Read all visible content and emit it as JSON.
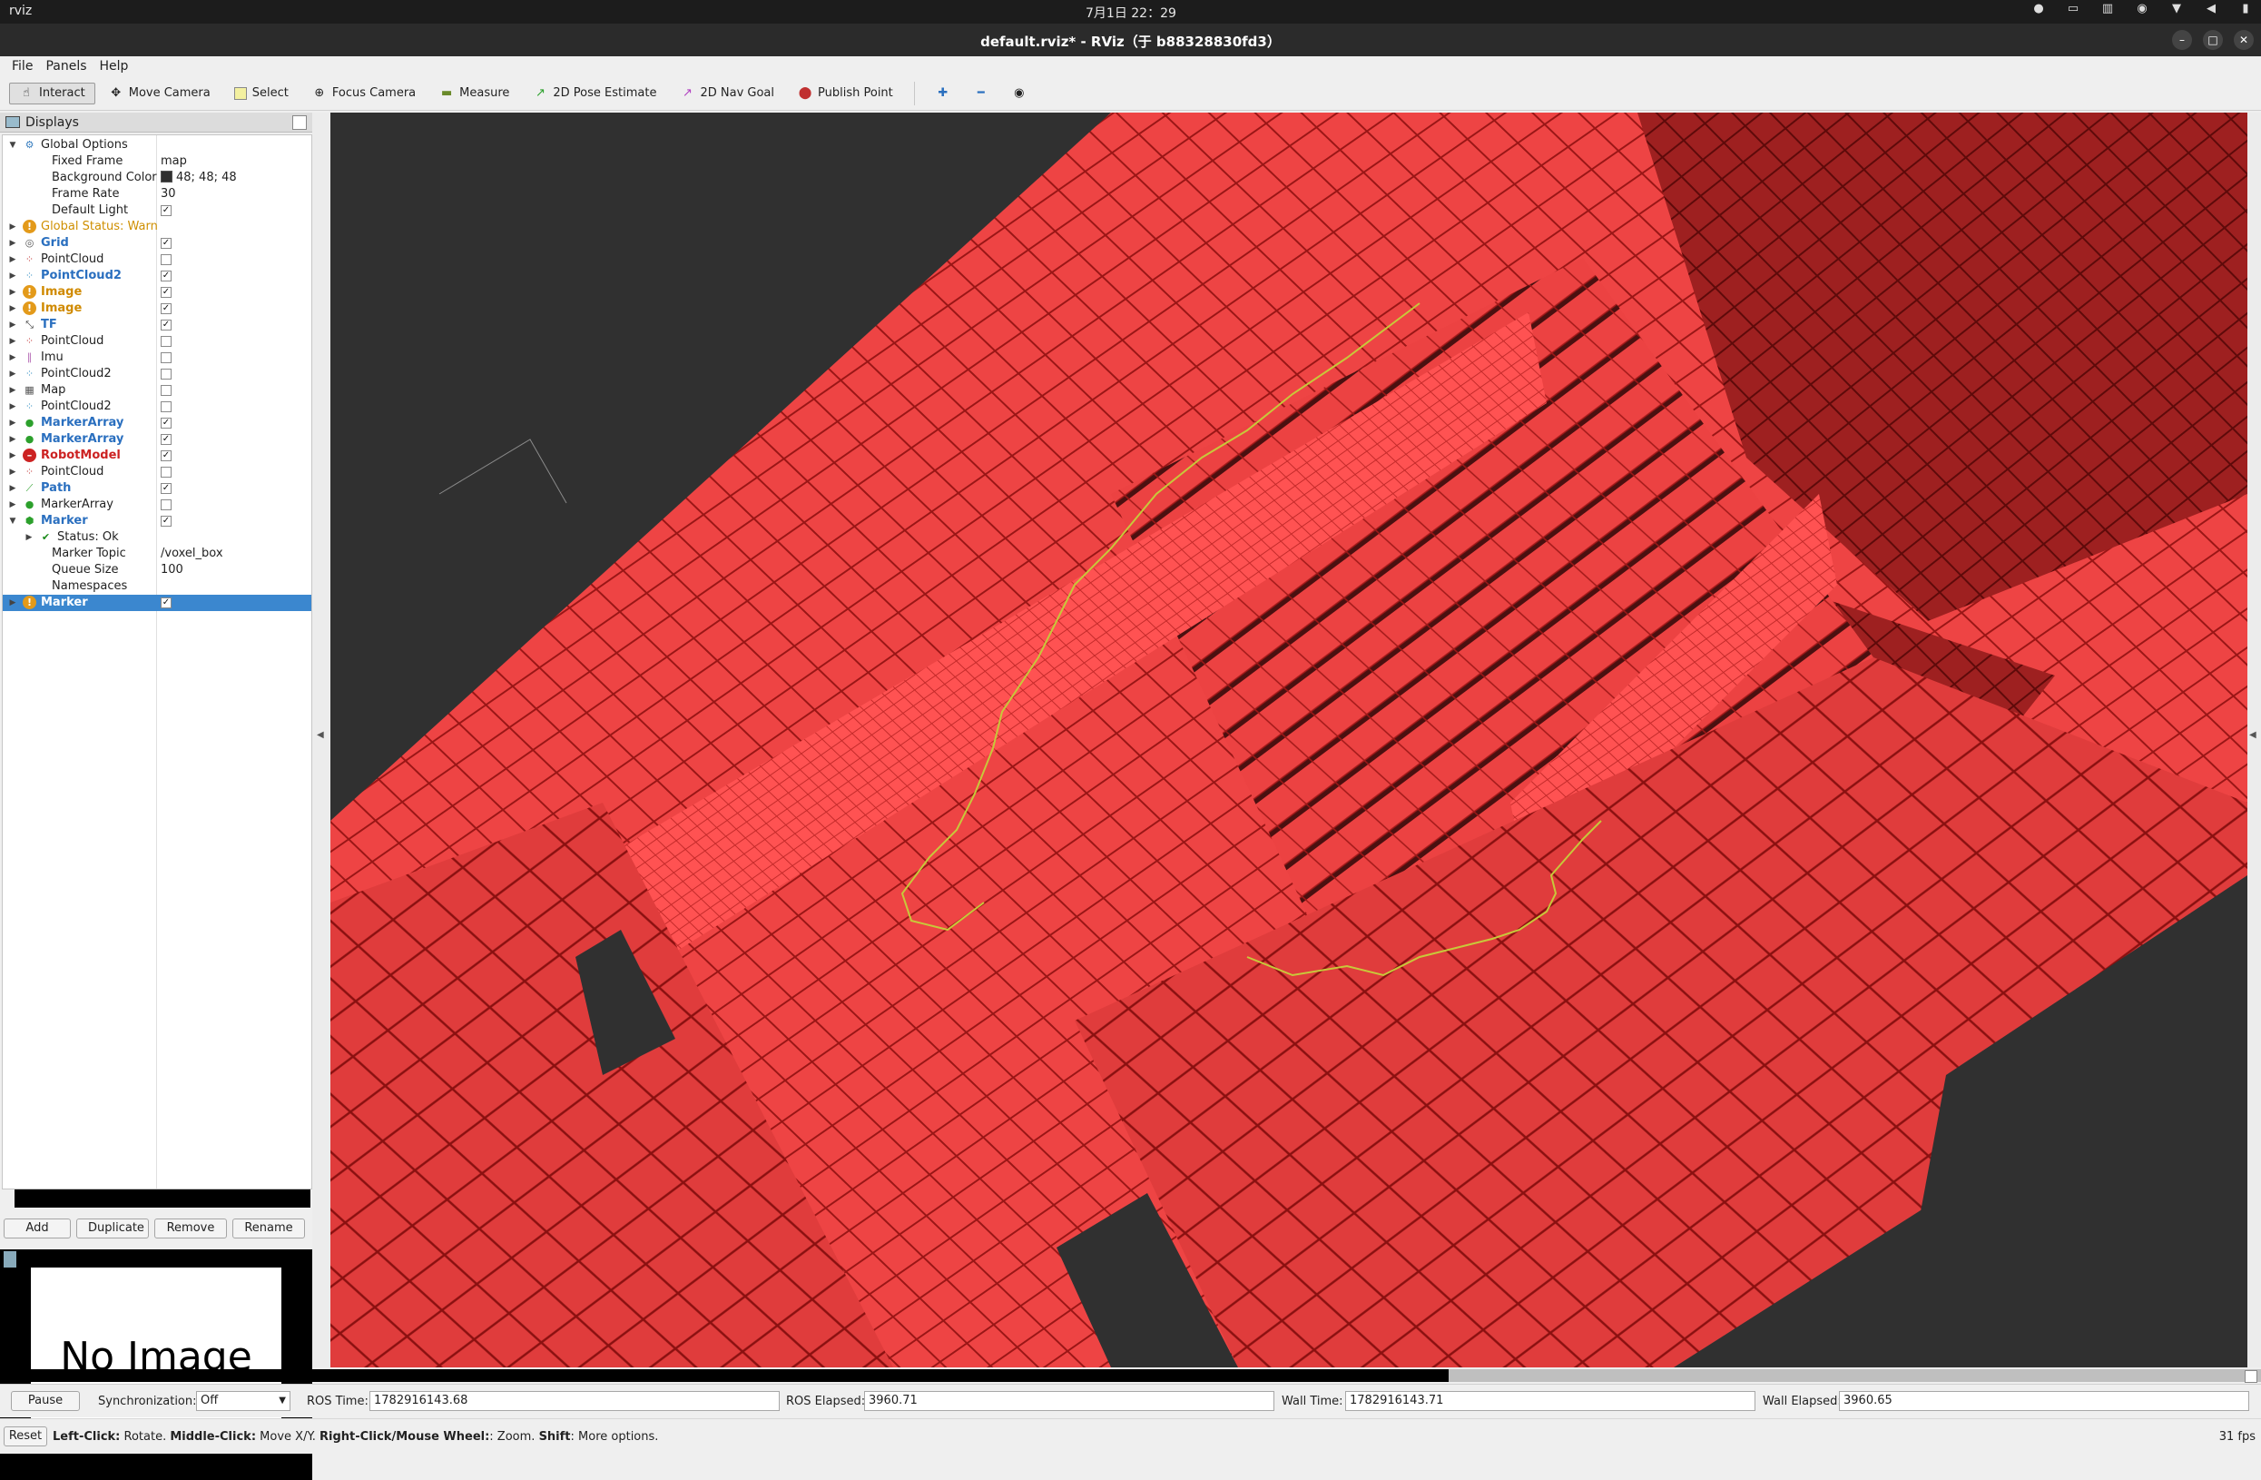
{
  "system_bar": {
    "app_name": "rviz",
    "clock": "7月1日  22：29"
  },
  "window": {
    "title": "default.rviz* - RViz（于 b88328830fd3）"
  },
  "menu": [
    "File",
    "Panels",
    "Help"
  ],
  "toolbar": {
    "tools": [
      {
        "label": "Interact",
        "icon": "hand-icon",
        "active": true
      },
      {
        "label": "Move Camera",
        "icon": "move-camera-icon"
      },
      {
        "label": "Select",
        "icon": "select-icon"
      },
      {
        "label": "Focus Camera",
        "icon": "focus-camera-icon"
      },
      {
        "label": "Measure",
        "icon": "measure-icon"
      },
      {
        "label": "2D Pose Estimate",
        "icon": "pose-estimate-icon"
      },
      {
        "label": "2D Nav Goal",
        "icon": "nav-goal-icon"
      },
      {
        "label": "Publish Point",
        "icon": "publish-point-icon"
      }
    ]
  },
  "displays_panel": {
    "title": "Displays",
    "rows": [
      {
        "label": "Global Options",
        "indent": 0,
        "expand": "open",
        "icon": "gear-icon"
      },
      {
        "label": "Fixed Frame",
        "indent": 1,
        "value": "map"
      },
      {
        "label": "Background Color",
        "indent": 1,
        "value": "48; 48; 48",
        "swatch": true
      },
      {
        "label": "Frame Rate",
        "indent": 1,
        "value": "30"
      },
      {
        "label": "Default Light",
        "indent": 1,
        "checkbox": true,
        "checked": true
      },
      {
        "label": "Global Status: Warn",
        "indent": 0,
        "expand": "closed",
        "icon": "warn-icon",
        "style": "warntxt"
      },
      {
        "label": "Grid",
        "indent": 0,
        "expand": "closed",
        "icon": "grid-icon",
        "style": "blue",
        "checkbox": true,
        "checked": true
      },
      {
        "label": "PointCloud",
        "indent": 0,
        "expand": "closed",
        "icon": "pointcloud-icon",
        "checkbox": true,
        "checked": false
      },
      {
        "label": "PointCloud2",
        "indent": 0,
        "expand": "closed",
        "icon": "pointcloud2-icon",
        "style": "blue",
        "checkbox": true,
        "checked": true
      },
      {
        "label": "Image",
        "indent": 0,
        "expand": "closed",
        "icon": "warn-icon",
        "style": "orange",
        "checkbox": true,
        "checked": true
      },
      {
        "label": "Image",
        "indent": 0,
        "expand": "closed",
        "icon": "warn-icon",
        "style": "orange",
        "checkbox": true,
        "checked": true
      },
      {
        "label": "TF",
        "indent": 0,
        "expand": "closed",
        "icon": "tf-icon",
        "style": "blue",
        "checkbox": true,
        "checked": true
      },
      {
        "label": "PointCloud",
        "indent": 0,
        "expand": "closed",
        "icon": "pointcloud-icon",
        "checkbox": true,
        "checked": false
      },
      {
        "label": "Imu",
        "indent": 0,
        "expand": "closed",
        "icon": "imu-icon",
        "checkbox": true,
        "checked": false
      },
      {
        "label": "PointCloud2",
        "indent": 0,
        "expand": "closed",
        "icon": "pointcloud2-icon",
        "checkbox": true,
        "checked": false
      },
      {
        "label": "Map",
        "indent": 0,
        "expand": "closed",
        "icon": "map-icon",
        "checkbox": true,
        "checked": false
      },
      {
        "label": "PointCloud2",
        "indent": 0,
        "expand": "closed",
        "icon": "pointcloud2-icon",
        "checkbox": true,
        "checked": false
      },
      {
        "label": "MarkerArray",
        "indent": 0,
        "expand": "closed",
        "icon": "marker-array-icon",
        "style": "blue",
        "checkbox": true,
        "checked": true
      },
      {
        "label": "MarkerArray",
        "indent": 0,
        "expand": "closed",
        "icon": "marker-array-icon",
        "style": "blue",
        "checkbox": true,
        "checked": true
      },
      {
        "label": "RobotModel",
        "indent": 0,
        "expand": "closed",
        "icon": "error-icon",
        "style": "red",
        "checkbox": true,
        "checked": true
      },
      {
        "label": "PointCloud",
        "indent": 0,
        "expand": "closed",
        "icon": "pointcloud-icon",
        "checkbox": true,
        "checked": false
      },
      {
        "label": "Path",
        "indent": 0,
        "expand": "closed",
        "icon": "path-icon",
        "style": "blue",
        "checkbox": true,
        "checked": true
      },
      {
        "label": "MarkerArray",
        "indent": 0,
        "expand": "closed",
        "icon": "marker-array-icon",
        "checkbox": true,
        "checked": false
      },
      {
        "label": "Marker",
        "indent": 0,
        "expand": "open",
        "icon": "marker-icon",
        "style": "blue",
        "checkbox": true,
        "checked": true
      },
      {
        "label": "Status: Ok",
        "indent": 1,
        "expand": "closed",
        "icon": "ok-check-icon"
      },
      {
        "label": "Marker Topic",
        "indent": 1,
        "value": "/voxel_box"
      },
      {
        "label": "Queue Size",
        "indent": 1,
        "value": "100"
      },
      {
        "label": "Namespaces",
        "indent": 1
      },
      {
        "label": "Marker",
        "indent": 0,
        "expand": "closed",
        "icon": "warn-icon",
        "style": "blue",
        "checkbox": true,
        "checked": true,
        "selected": true
      }
    ],
    "buttons": {
      "add": "Add",
      "duplicate": "Duplicate",
      "remove": "Remove",
      "rename": "Rename"
    }
  },
  "image_panel": {
    "text": "No Image"
  },
  "time_panel": {
    "pause": "Pause",
    "sync_label": "Synchronization:",
    "sync_value": "Off",
    "ros_time_label": "ROS Time:",
    "ros_time": "1782916143.68",
    "ros_elapsed_label": "ROS Elapsed:",
    "ros_elapsed": "3960.71",
    "wall_time_label": "Wall Time:",
    "wall_time": "1782916143.71",
    "wall_elapsed_label": "Wall Elapsed:",
    "wall_elapsed": "3960.65"
  },
  "status_bar": {
    "reset": "Reset",
    "hint_1": "Left-Click:",
    "hint_2": " Rotate. ",
    "hint_3": "Middle-Click:",
    "hint_4": " Move X/Y. ",
    "hint_5": "Right-Click/Mouse Wheel:",
    "hint_6": ": Zoom. ",
    "hint_7": "Shift",
    "hint_8": ": More options.",
    "fps": "31 fps"
  },
  "colors": {
    "voxel_fill": "#ee4444",
    "voxel_edge": "#9a1616",
    "path_line": "#c8c83a",
    "background": "#303030"
  }
}
